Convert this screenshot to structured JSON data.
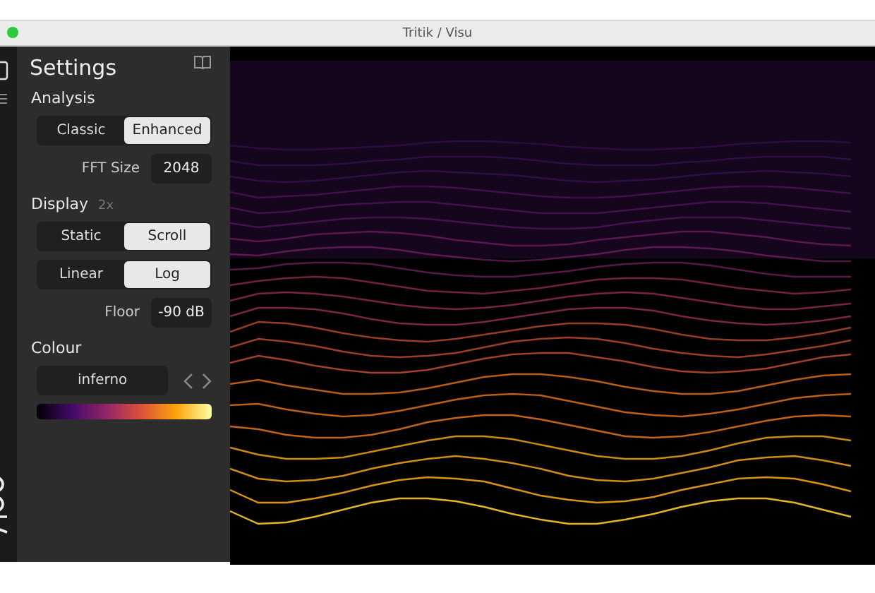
{
  "window": {
    "title": "Tritik / Visu"
  },
  "sidebar": {
    "title": "Settings",
    "sections": [
      {
        "title": "Analysis",
        "rows": [
          {
            "kind": "segmented",
            "options": [
              {
                "label": "Classic",
                "selected": false
              },
              {
                "label": "Enhanced",
                "selected": true
              }
            ]
          },
          {
            "kind": "field",
            "label": "FFT Size",
            "value": "2048"
          }
        ]
      },
      {
        "title": "Display",
        "badge": "2x",
        "rows": [
          {
            "kind": "segmented",
            "options": [
              {
                "label": "Static",
                "selected": false
              },
              {
                "label": "Scroll",
                "selected": true
              }
            ]
          },
          {
            "kind": "segmented",
            "options": [
              {
                "label": "Linear",
                "selected": false
              },
              {
                "label": "Log",
                "selected": true
              }
            ]
          },
          {
            "kind": "field",
            "label": "Floor",
            "value": "-90 dB"
          }
        ]
      },
      {
        "title": "Colour",
        "rows": [
          {
            "kind": "picker",
            "value": "inferno"
          },
          {
            "kind": "gradient"
          }
        ]
      }
    ]
  }
}
